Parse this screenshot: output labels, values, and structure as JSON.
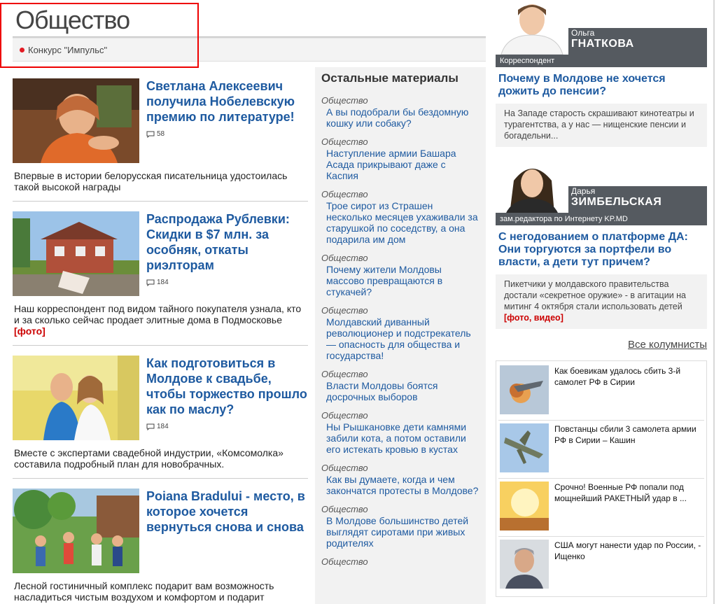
{
  "header": {
    "title": "Общество",
    "subnav_item": "Конкурс \"Импульс\""
  },
  "articles": [
    {
      "title": "Светлана Алексеевич получила Нобелевскую премию по литературе!",
      "comments": "58",
      "lead": "Впервые в истории белорусская писательница удостоилась такой высокой награды",
      "tag": ""
    },
    {
      "title": "Распродажа Рублевки: Скидки в $7 млн. за особняк, откаты риэлторам",
      "comments": "184",
      "lead": "Наш корреспондент под видом тайного покупателя узнала, кто и за сколько сейчас продает элитные дома в Подмосковье",
      "tag": "[фото]"
    },
    {
      "title": "Как подготовиться в Молдове к свадьбе, чтобы торжество прошло как по маслу?",
      "comments": "184",
      "lead": "Вместе с экспертами свадебной индустрии, «Комсомолка» составила подробный план для новобрачных.",
      "tag": ""
    },
    {
      "title": "Poiana Bradului - место, в которое хочется вернуться снова и снова",
      "comments": "",
      "lead": "Лесной гостиничный комплекс подарит вам возможность насладиться чистым воздухом и комфортом и подарит",
      "tag": ""
    }
  ],
  "others": {
    "heading": "Остальные материалы",
    "items": [
      {
        "category": "Общество",
        "title": "А вы подобрали бы бездомную кошку или собаку?"
      },
      {
        "category": "Общество",
        "title": "Наступление армии Башара Асада прикрывают даже с Каспия"
      },
      {
        "category": "Общество",
        "title": "Трое сирот из Страшен несколько месяцев ухаживали за старушкой по соседству, а она подарила им дом"
      },
      {
        "category": "Общество",
        "title": "Почему жители Молдовы массово превращаются в стукачей?"
      },
      {
        "category": "Общество",
        "title": "Молдавский диванный революционер и подстрекатель — опасность для общества и государства!"
      },
      {
        "category": "Общество",
        "title": "Власти Молдовы боятся досрочных выборов"
      },
      {
        "category": "Общество",
        "title": "Ны Рышкановке дети камнями забили кота, а потом оставили его истекать кровью в кустах"
      },
      {
        "category": "Общество",
        "title": "Как вы думаете, когда и чем закончатся протесты в Молдове?"
      },
      {
        "category": "Общество",
        "title": "В Молдове большинство детей выглядят сиротами при живых родителях"
      },
      {
        "category": "Общество",
        "title": ""
      }
    ]
  },
  "columnists": [
    {
      "first_name": "Ольга",
      "last_name": "ГНАТКОВА",
      "role": "Корреспондент",
      "title": "Почему в Молдове не хочется дожить до пенсии?",
      "lead": "На Западе старость скрашивают кинотеатры и турагентства, а у нас — нищенские пенсии и богадельни...",
      "tag": ""
    },
    {
      "first_name": "Дарья",
      "last_name": "ЗИМБЕЛЬСКАЯ",
      "role": "зам.редактора по Интернету KP.MD",
      "title": "С негодованием о платформе ДА: Они торгуются за портфели во власти, а дети тут причем?",
      "lead": "Пикетчики у молдавского правительства достали «секретное оружие» - в агитации на митинг 4 октября стали использовать детей",
      "tag": "[фото, видео]"
    }
  ],
  "all_columnists_label": "Все колумнисты",
  "news": [
    {
      "title": "Как боевикам удалось сбить 3-й самолет РФ в Сирии"
    },
    {
      "title": "Повстанцы сбили 3 самолета армии РФ в Сирии – Кашин"
    },
    {
      "title": "Срочно! Военные РФ попали под мощнейший РАКЕТНЫЙ удар в ..."
    },
    {
      "title": "США могут нанести удар по России, - Ищенко"
    }
  ],
  "colors": {
    "link": "#1e5aa0",
    "accent_red": "#e31b23",
    "band": "#555a60"
  }
}
